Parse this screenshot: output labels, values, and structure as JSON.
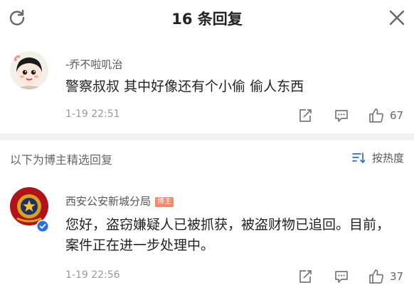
{
  "header": {
    "title": "16 条回复"
  },
  "comment1": {
    "username": "-乔不啦叽治",
    "text": "警察叔叔 其中好像还有个小偷 偷人东西",
    "time": "1-19 22:51",
    "likes": "67"
  },
  "section": {
    "label": "以下为博主精选回复",
    "sort_label": "按热度"
  },
  "comment2": {
    "username": "西安公安新城分局",
    "badge": "博主",
    "text": "您好，盗窃嫌疑人已被抓获，被盗财物已追回。目前，案件正在进一步处理中。",
    "time": "1-19 22:56",
    "likes": "37"
  },
  "colors": {
    "accent_icon": "#2a6fe0",
    "badge": "#f5866e",
    "police_red": "#c8102e"
  },
  "icons": [
    "refresh-icon",
    "close-icon",
    "share-icon",
    "comment-icon",
    "like-icon",
    "sort-icon",
    "verified-icon"
  ]
}
